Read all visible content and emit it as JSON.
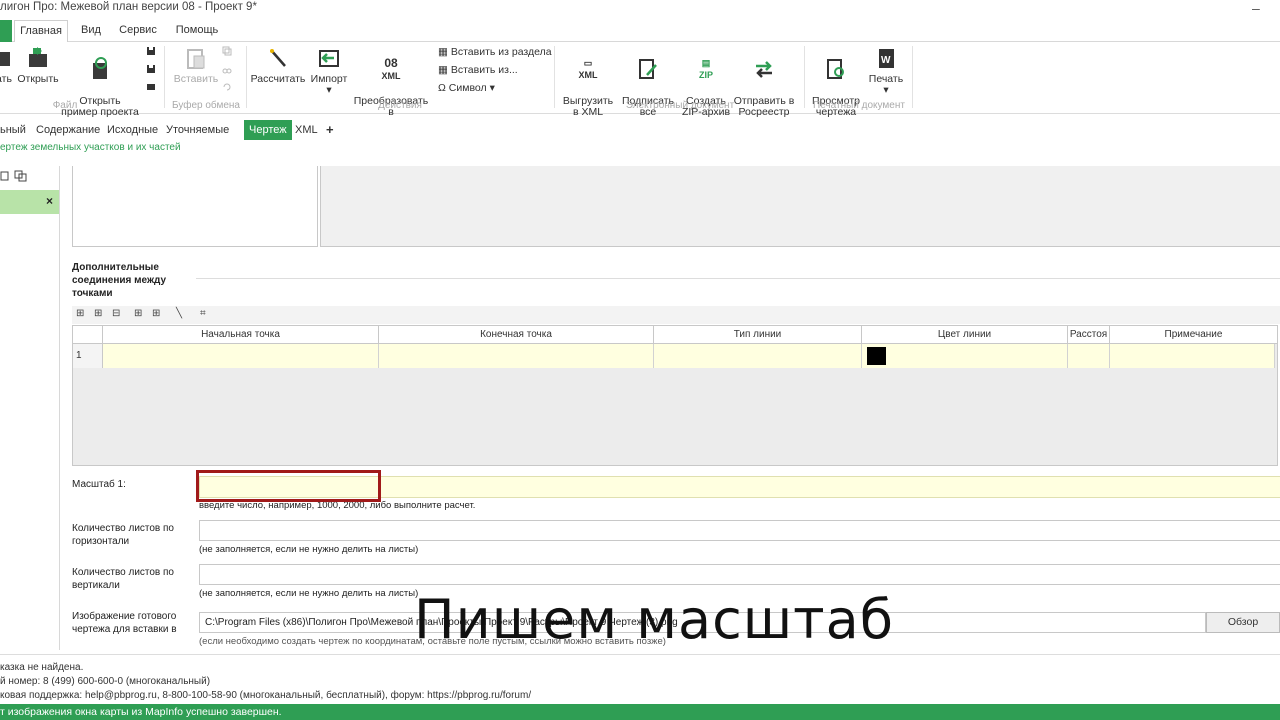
{
  "window": {
    "title": "лигон Про: Межевой план версии 08 - Проект 9*",
    "minimize": "–"
  },
  "menu": {
    "tabs": [
      "Главная",
      "Вид",
      "Сервис",
      "Помощь"
    ]
  },
  "ribbon": {
    "file": {
      "label": "Файл",
      "buttons": [
        "ать",
        "Открыть",
        "Открыть\nпример проекта"
      ]
    },
    "clipboard": {
      "label": "Буфер обмена",
      "paste": "Вставить"
    },
    "actions": {
      "label": "Действия",
      "calc": "Рассчитать",
      "import": "Импорт",
      "transform": "Преобразовать\nв",
      "insert_from_section": "Вставить из раздела",
      "insert_from": "Вставить из...",
      "symbol": "Символ",
      "icon_08": "08",
      "icon_xml": "XML"
    },
    "edoc": {
      "label": "Электронный документ",
      "export_xml": "Выгрузить\nв XML",
      "sign": "Подписать\nвсе",
      "zip": "Создать\nZIP-архив",
      "send": "Отправить в\nРосреестр",
      "icon_xml": "XML",
      "icon_zip": "ZIP"
    },
    "print": {
      "label": "Печатный документ",
      "preview": "Просмотр\nчертежа",
      "print": "Печать"
    }
  },
  "subtabs": [
    "ьный",
    "Содержание",
    "Исходные",
    "Уточняемые",
    "Чертеж",
    "XML",
    "+"
  ],
  "breadcrumb": "ертеж земельных участков и их частей",
  "form": {
    "additional_label": "Дополнительные\nсоединения между\nточками",
    "grid": {
      "columns": [
        "Начальная точка",
        "Конечная точка",
        "Тип линии",
        "Цвет линии",
        "Расстоя",
        "Примечание"
      ],
      "rows": [
        {
          "num": "1",
          "color": "#000000"
        }
      ]
    },
    "scale_label": "Масштаб 1:",
    "scale_value": "",
    "scale_hint": "введите число, например, 1000, 2000, либо выполните расчет.",
    "horiz_label": "Количество листов по\nгоризонтали",
    "horiz_hint": "(не заполняется, если не нужно делить на листы)",
    "vert_label": "Количество листов по\nвертикали",
    "vert_hint": "(не заполняется, если не нужно делить на листы)",
    "image_label": "Изображение готового\nчертежа для вставки в",
    "image_path": "C:\\Program Files (x86)\\Полигон Про\\Межевой план\\Проекты\\Проект 9\\Растры\\Проект 9 Чертеж (3).png",
    "browse": "Обзор",
    "image_hint": "(если необходимо создать чертеж по координатам, оставьте поле пустым, ссылки можно вставить позже)"
  },
  "status": {
    "line1": "казка не найдена.",
    "line2": "й номер: 8 (499) 600-600-0 (многоканальный)",
    "line3": "ковая поддержка: help@pbprog.ru, 8-800-100-58-90 (многоканальный, бесплатный), форум: https://pbprog.ru/forum/",
    "greenbar": "т изображения окна карты из MapInfo успешно завершен."
  },
  "overlay_caption": "Пишем масштаб"
}
